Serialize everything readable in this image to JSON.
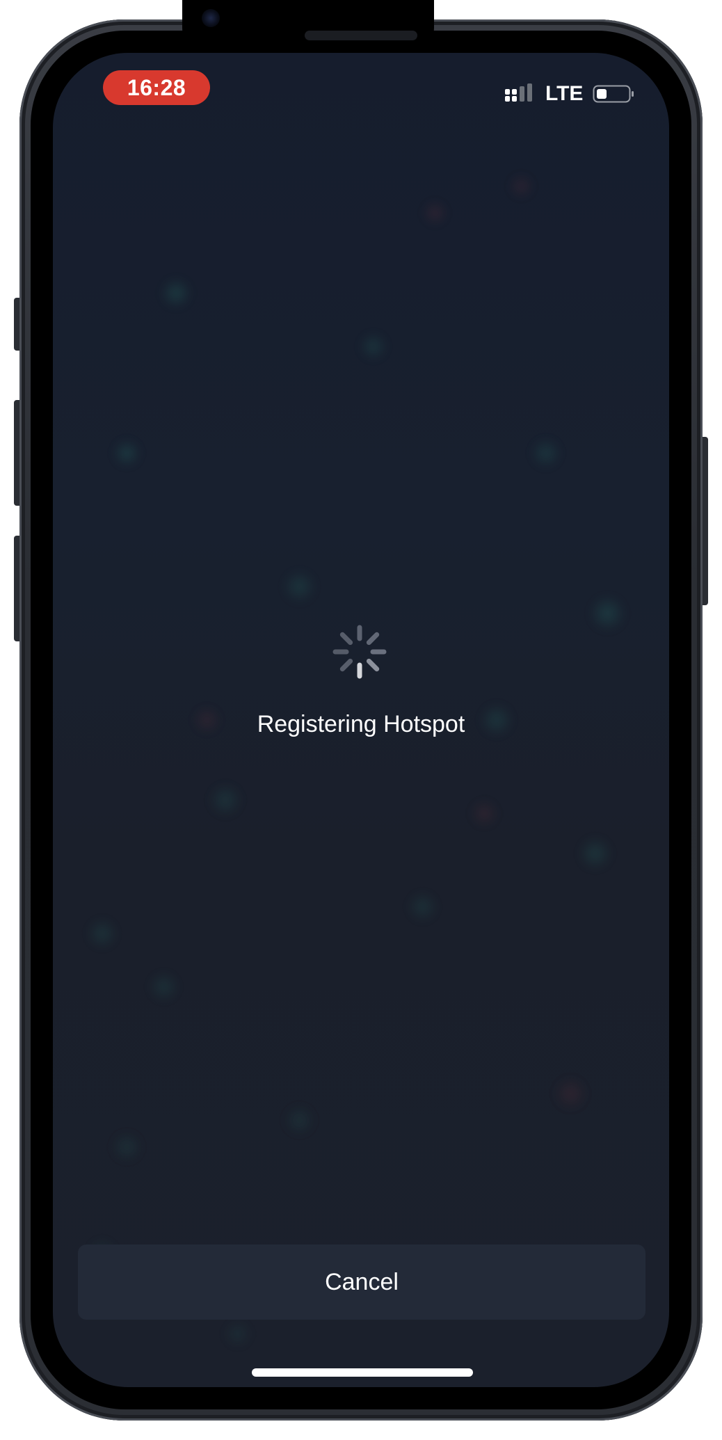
{
  "status_bar": {
    "time": "16:28",
    "network": "LTE",
    "icons": [
      "signal-icon",
      "battery-icon"
    ],
    "time_pill_color": "#d8392e"
  },
  "main": {
    "loading_icon": "spinner-icon",
    "status_message": "Registering Hotspot"
  },
  "footer": {
    "cancel_label": "Cancel"
  },
  "colors": {
    "background": "#18202f",
    "button_bg": "#232a38",
    "text": "#ffffff"
  }
}
